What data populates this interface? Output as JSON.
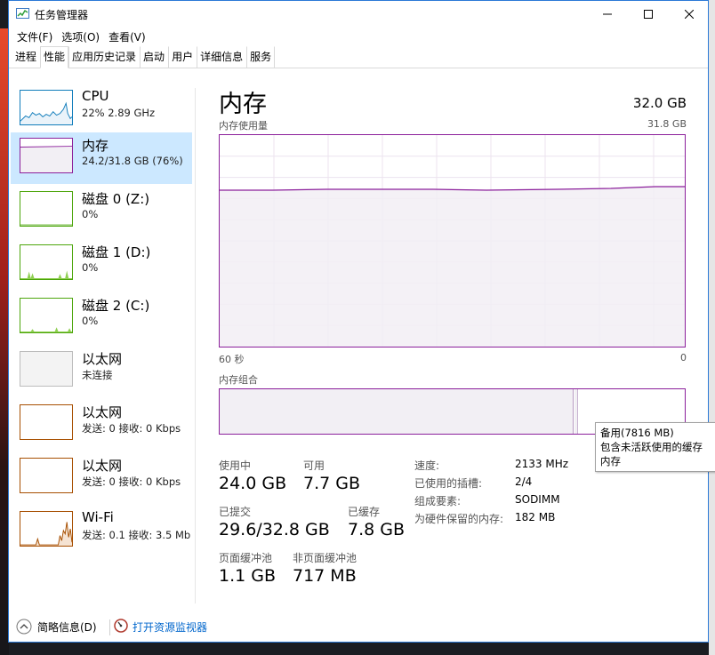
{
  "window": {
    "title": "任务管理器"
  },
  "menu": [
    "文件(F)",
    "选项(O)",
    "查看(V)"
  ],
  "tabs": [
    {
      "label": "进程",
      "active": false
    },
    {
      "label": "性能",
      "active": true
    },
    {
      "label": "应用历史记录",
      "active": false
    },
    {
      "label": "启动",
      "active": false
    },
    {
      "label": "用户",
      "active": false
    },
    {
      "label": "详细信息",
      "active": false
    },
    {
      "label": "服务",
      "active": false
    }
  ],
  "sidebar": [
    {
      "name": "CPU",
      "sub": "22%  2.89 GHz",
      "color": "#117dbb"
    },
    {
      "name": "内存",
      "sub": "24.2/31.8 GB (76%)",
      "color": "#8b1f9b"
    },
    {
      "name": "磁盘 0 (Z:)",
      "sub": "0%",
      "color": "#4da60c"
    },
    {
      "name": "磁盘 1 (D:)",
      "sub": "0%",
      "color": "#4da60c"
    },
    {
      "name": "磁盘 2 (C:)",
      "sub": "0%",
      "color": "#4da60c"
    },
    {
      "name": "以太网",
      "sub": "未连接",
      "color": "#bcbcbc"
    },
    {
      "name": "以太网",
      "sub": "发送: 0 接收: 0 Kbps",
      "color": "#a74f01"
    },
    {
      "name": "以太网",
      "sub": "发送: 0 接收: 0 Kbps",
      "color": "#a74f01"
    },
    {
      "name": "Wi-Fi",
      "sub": "发送: 0.1 接收: 3.5 Mb",
      "color": "#a74f01"
    }
  ],
  "main": {
    "title": "内存",
    "total": "32.0 GB",
    "usage_label": "内存使用量",
    "usage_max": "31.8 GB",
    "time_left": "60 秒",
    "time_right": "0",
    "composition_label": "内存组合",
    "usage_fraction": 0.76
  },
  "tooltip": {
    "line1": "备用(7816 MB)",
    "line2": "包含未活跃使用的缓存",
    "line3": "内存"
  },
  "stats": {
    "in_use_label": "使用中",
    "in_use": "24.0 GB",
    "available_label": "可用",
    "available": "7.7 GB",
    "committed_label": "已提交",
    "committed": "29.6/32.8 GB",
    "cached_label": "已缓存",
    "cached": "7.8 GB",
    "paged_label": "页面缓冲池",
    "paged": "1.1 GB",
    "nonpaged_label": "非页面缓冲池",
    "nonpaged": "717 MB"
  },
  "details": [
    {
      "label": "速度:",
      "value": "2133 MHz"
    },
    {
      "label": "已使用的插槽:",
      "value": "2/4"
    },
    {
      "label": "组成要素:",
      "value": "SODIMM"
    },
    {
      "label": "为硬件保留的内存:",
      "value": "182 MB"
    }
  ],
  "footer": {
    "fewer_details": "简略信息(D)",
    "resource_monitor": "打开资源监视器"
  },
  "colors": {
    "accent_memory": "#8b1f9b",
    "selected_bg": "#cce8ff",
    "link": "#0066cc"
  }
}
